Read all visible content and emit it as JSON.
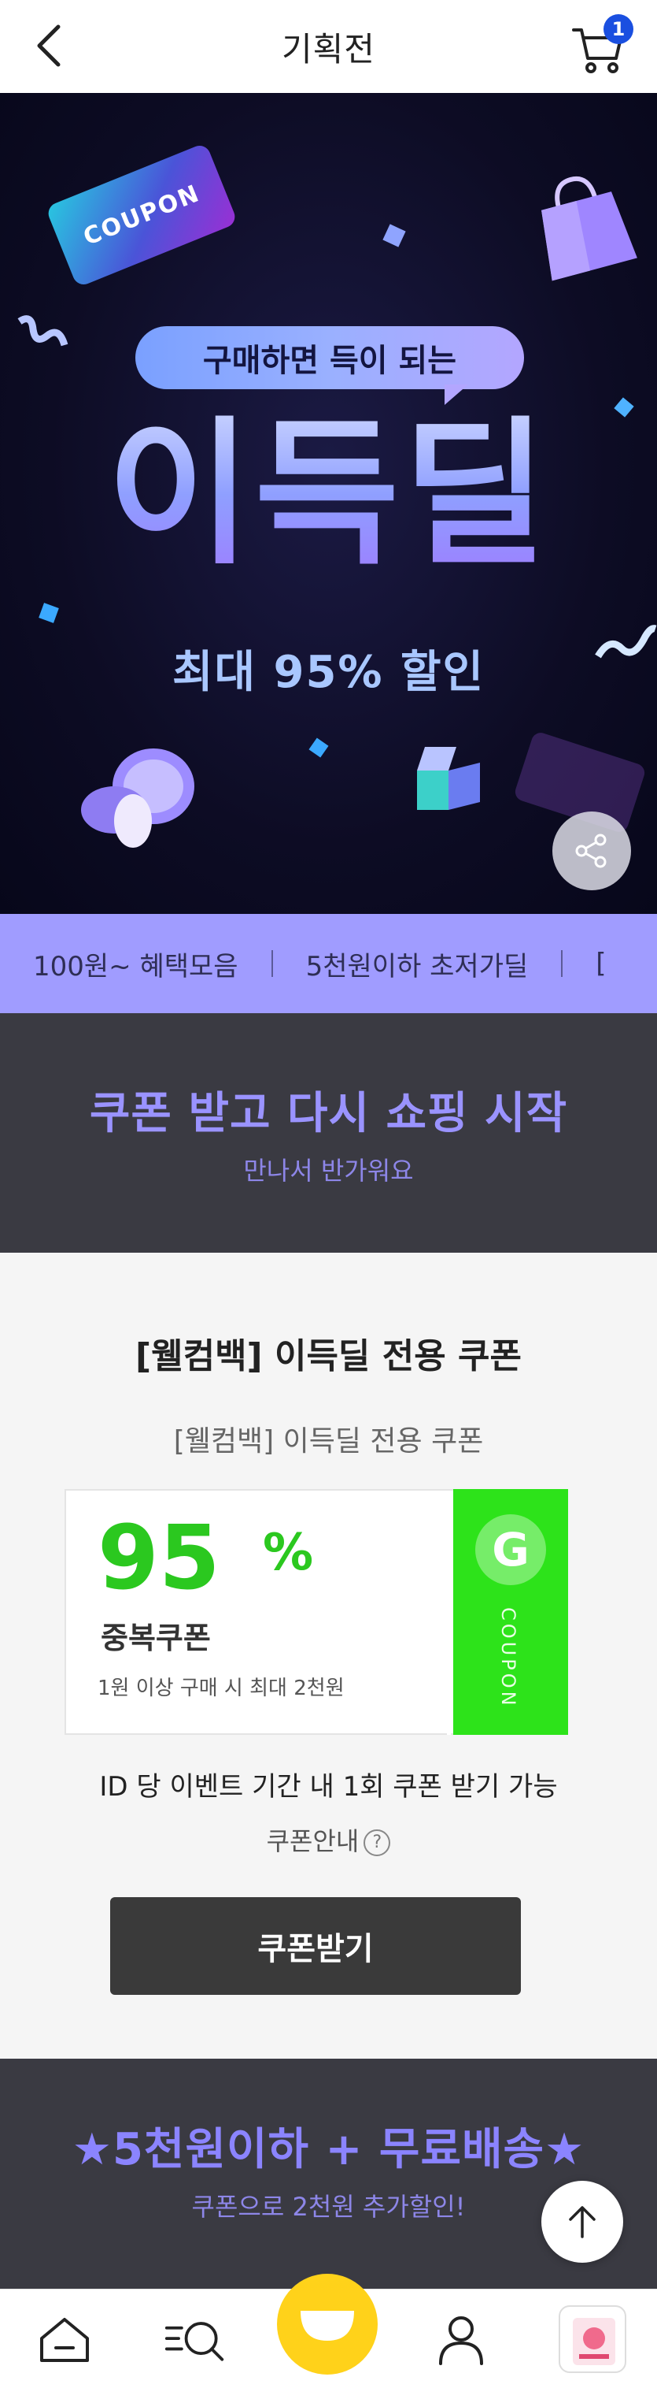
{
  "header": {
    "title": "기획전",
    "cart_count": "1"
  },
  "hero": {
    "coupon_ticket": "COUPON",
    "subtitle": "구매하면 득이 되는",
    "main_title": "이득딜",
    "discount": "최대 95% 할인"
  },
  "menu_strip": {
    "items": [
      "100원~ 혜택모음",
      "5천원이하 초저가딜",
      "["
    ]
  },
  "coupon_header": {
    "title": "쿠폰 받고 다시 쇼핑 시작",
    "subtitle": "만나서 반가워요"
  },
  "coupon_section": {
    "title": "[웰컴백] 이득딜 전용 쿠폰",
    "subtitle": "[웰컴백] 이득딜 전용 쿠폰",
    "card": {
      "percent": "95",
      "percent_sign": "%",
      "kind": "중복쿠폰",
      "condition": "1원 이상 구매 시 최대 2천원",
      "brand_letter": "G",
      "vertical_label": "COUPON"
    },
    "limit_text": "ID 당 이벤트 기간 내 1회 쿠폰 받기 가능",
    "guide_label": "쿠폰안내",
    "guide_q": "?",
    "button_label": "쿠폰받기"
  },
  "delivery_header": {
    "title": "★5천원이하 + 무료배송★",
    "subtitle": "쿠폰으로 2천원 추가할인!"
  },
  "colors": {
    "accent_purple": "#a09cff",
    "coupon_green": "#2de31a",
    "cart_badge": "#1a4fe0",
    "center_tab": "#ffd21a"
  }
}
